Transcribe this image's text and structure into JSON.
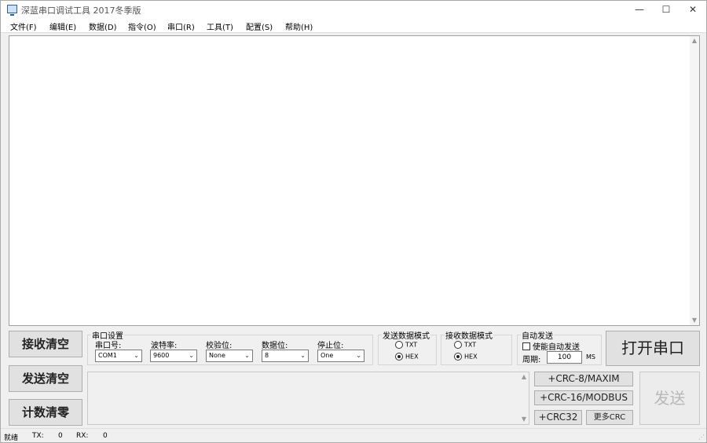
{
  "window": {
    "title": "深蓝串口调试工具 2017冬季版",
    "min": "—",
    "max": "☐",
    "close": "✕"
  },
  "menu": [
    "文件(F)",
    "编辑(E)",
    "数据(D)",
    "指令(O)",
    "串口(R)",
    "工具(T)",
    "配置(S)",
    "帮助(H)"
  ],
  "buttons": {
    "clear_receive": "接收清空",
    "clear_send": "发送清空",
    "reset_count": "计数清零",
    "open_port": "打开串口",
    "send": "发送"
  },
  "serial_settings": {
    "title": "串口设置",
    "port_label": "串口号:",
    "port_value": "COM1",
    "baud_label": "波特率:",
    "baud_value": "9600",
    "parity_label": "校验位:",
    "parity_value": "None",
    "databits_label": "数据位:",
    "databits_value": "8",
    "stopbits_label": "停止位:",
    "stopbits_value": "One"
  },
  "send_mode": {
    "title": "发送数据模式",
    "txt": "TXT",
    "hex": "HEX",
    "selected": "HEX"
  },
  "recv_mode": {
    "title": "接收数据模式",
    "txt": "TXT",
    "hex": "HEX",
    "selected": "HEX"
  },
  "auto_send": {
    "title": "自动发送",
    "enable_label": "使能自动发送",
    "enabled": false,
    "period_label": "周期:",
    "period_value": "100",
    "unit": "MS"
  },
  "crc": {
    "crc8": "+CRC-8/MAXIM",
    "crc16": "+CRC-16/MODBUS",
    "crc32": "+CRC32",
    "more": "更多CRC"
  },
  "status": {
    "state": "就绪",
    "tx_label": "TX:",
    "tx_value": "0",
    "rx_label": "RX:",
    "rx_value": "0"
  },
  "icons": {
    "app": "serial-port-app-icon",
    "scroll_up": "▲",
    "scroll_down": "▼",
    "dropdown": "⌄",
    "grip": "⋰"
  }
}
